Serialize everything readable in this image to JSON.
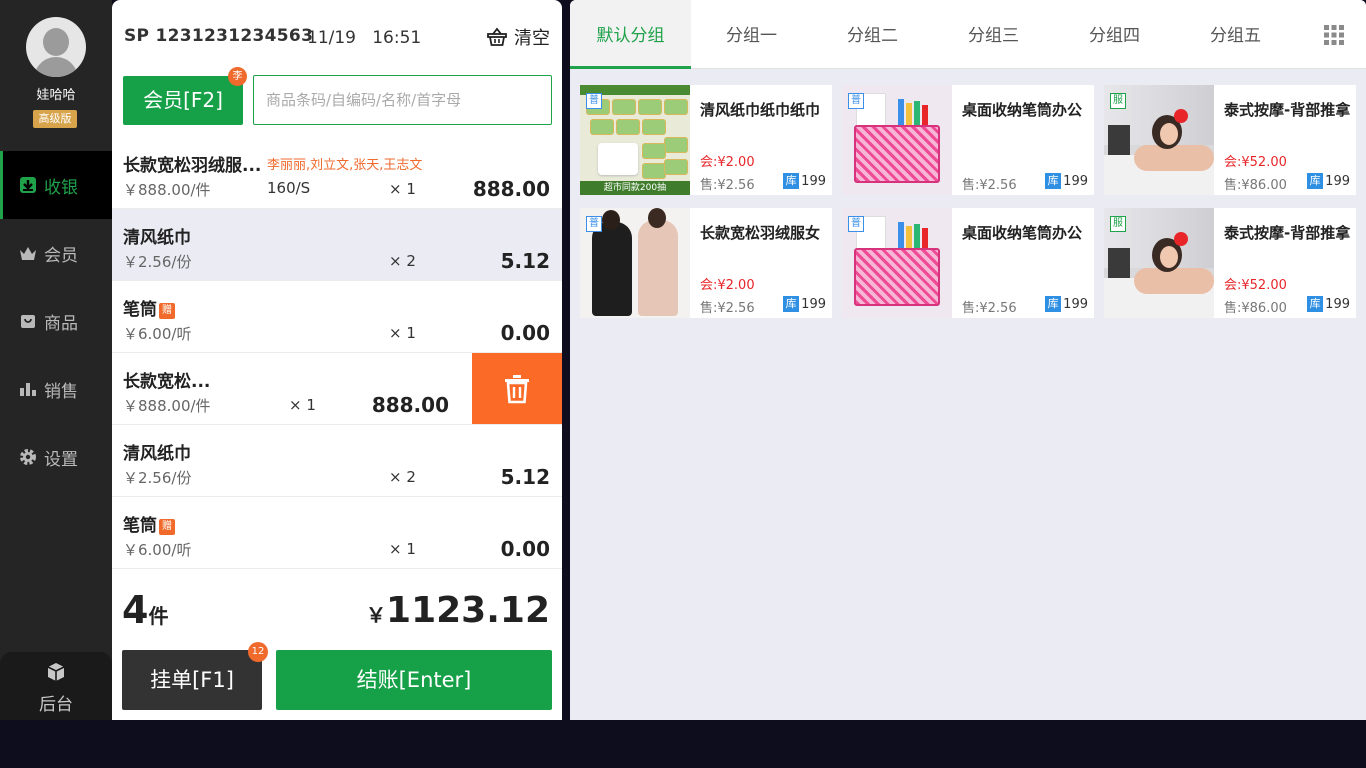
{
  "user": {
    "name": "娃哈哈",
    "edition": "高级版"
  },
  "nav": [
    {
      "label": "收银",
      "icon": "download-arrow-icon",
      "active": true
    },
    {
      "label": "会员",
      "icon": "crown-icon"
    },
    {
      "label": "商品",
      "icon": "bag-icon"
    },
    {
      "label": "销售",
      "icon": "bar-chart-icon"
    },
    {
      "label": "设置",
      "icon": "gear-icon"
    }
  ],
  "backend": {
    "label": "后台",
    "icon": "cube-icon"
  },
  "order": {
    "number": "SP 1231231234563",
    "date": "11/19",
    "time": "16:51",
    "clear_label": "清空"
  },
  "member_button": {
    "label": "会员[F2]",
    "badge": "李"
  },
  "search": {
    "placeholder": "商品条码/自编码/名称/首字母",
    "value": ""
  },
  "cart_lines": [
    {
      "name": "长款宽松羽绒服...",
      "members": "李丽丽,刘立文,张天,王志文",
      "gift": "",
      "price": "￥888.00/件",
      "spec": "160/S",
      "qty": "× 1",
      "amount": "888.00"
    },
    {
      "name": "清风纸巾",
      "members": "",
      "gift": "",
      "price": "￥2.56/份",
      "spec": "",
      "qty": "× 2",
      "amount": "5.12"
    },
    {
      "name": "笔筒",
      "members": "",
      "gift": "赠",
      "price": "￥6.00/听",
      "spec": "",
      "qty": "× 1",
      "amount": "0.00"
    },
    {
      "name": "长款宽松...",
      "members": "",
      "gift": "",
      "price": "￥888.00/件",
      "spec": "",
      "qty": "× 1",
      "amount": "888.00"
    },
    {
      "name": "清风纸巾",
      "members": "",
      "gift": "",
      "price": "￥2.56/份",
      "spec": "",
      "qty": "× 2",
      "amount": "5.12"
    },
    {
      "name": "笔筒",
      "members": "",
      "gift": "赠",
      "price": "￥6.00/听",
      "spec": "",
      "qty": "× 1",
      "amount": "0.00"
    }
  ],
  "totals": {
    "count": "4",
    "count_unit": "件",
    "currency": "￥",
    "amount": "1123.12"
  },
  "hold_button": {
    "label": "挂单[F1]",
    "badge": "12"
  },
  "checkout_button": {
    "label": "结账[Enter]"
  },
  "tabs": [
    "默认分组",
    "分组一",
    "分组二",
    "分组三",
    "分组四",
    "分组五"
  ],
  "products": [
    {
      "name": "清风纸巾纸巾纸巾",
      "type": "普",
      "member_price": "会:¥2.00",
      "sale_price": "售:¥2.56",
      "stock_label": "库",
      "stock": "199",
      "image": "tissue",
      "image_text": "超市同款200抽"
    },
    {
      "name": "桌面收纳笔筒办公",
      "type": "普",
      "member_price": "",
      "sale_price": "售:¥2.56",
      "stock_label": "库",
      "stock": "199",
      "image": "pen"
    },
    {
      "name": "泰式按摩-背部推拿",
      "type": "服",
      "member_price": "会:¥52.00",
      "sale_price": "售:¥86.00",
      "stock_label": "库",
      "stock": "199",
      "image": "spa"
    },
    {
      "name": "长款宽松羽绒服女",
      "type": "普",
      "member_price": "会:¥2.00",
      "sale_price": "售:¥2.56",
      "stock_label": "库",
      "stock": "199",
      "image": "coat"
    },
    {
      "name": "桌面收纳笔筒办公",
      "type": "普",
      "member_price": "",
      "sale_price": "售:¥2.56",
      "stock_label": "库",
      "stock": "199",
      "image": "pen"
    },
    {
      "name": "泰式按摩-背部推拿",
      "type": "服",
      "member_price": "会:¥52.00",
      "sale_price": "售:¥86.00",
      "stock_label": "库",
      "stock": "199",
      "image": "spa"
    }
  ],
  "colors": {
    "accent": "#1fa24a",
    "orange": "#fb6a27",
    "red": "#e8262a",
    "blue": "#2f8fe3"
  }
}
